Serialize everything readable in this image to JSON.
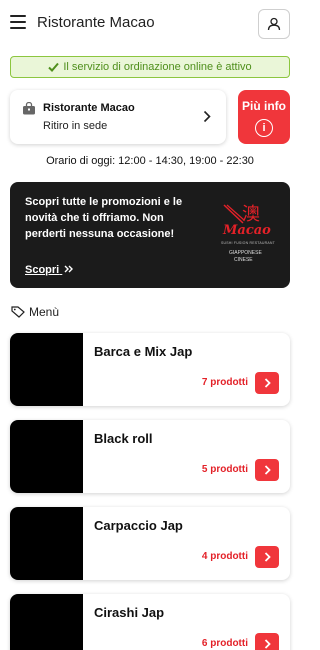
{
  "header": {
    "title": "Ristorante Macao",
    "menu_icon": "hamburger-icon",
    "user_icon": "user-icon"
  },
  "status": {
    "text": "Il servizio di ordinazione online è attivo",
    "icon": "check-icon",
    "color": "#4f8f1c"
  },
  "store": {
    "name": "Ristorante Macao",
    "mode": "Ritiro in sede",
    "icon": "shopping-bag-icon"
  },
  "more_info": {
    "label": "Più info",
    "icon": "info-icon",
    "glyph": "i"
  },
  "hours": {
    "label": "Orario di oggi:",
    "value": "12:00 - 14:30, 19:00 - 22:30"
  },
  "promo": {
    "text": "Scopri tutte le promozioni e le novità che ti offriamo. Non perderti nessuna occasione!",
    "link": "Scopri",
    "link_icon": "double-chevron-right-icon",
    "logo": {
      "glyph": "澳",
      "word": "Macao",
      "tagline": "SUSHI FUSION RESTAURANT",
      "cuisine1": "GIAPPONESE",
      "cuisine2": "CINESE"
    }
  },
  "menu": {
    "heading": "Menù",
    "icon": "tag-icon",
    "categories": [
      {
        "name": "Barca e Mix Jap",
        "count": "7 prodotti"
      },
      {
        "name": "Black roll",
        "count": "5 prodotti"
      },
      {
        "name": "Carpaccio Jap",
        "count": "4 prodotti"
      },
      {
        "name": "Cirashi Jap",
        "count": "6 prodotti"
      }
    ]
  },
  "colors": {
    "accent": "#f0363b",
    "count_text": "#e32128",
    "banner_bg": "#eaf6d8",
    "banner_border": "#8cc63f",
    "promo_bg": "#1b1b1b"
  }
}
